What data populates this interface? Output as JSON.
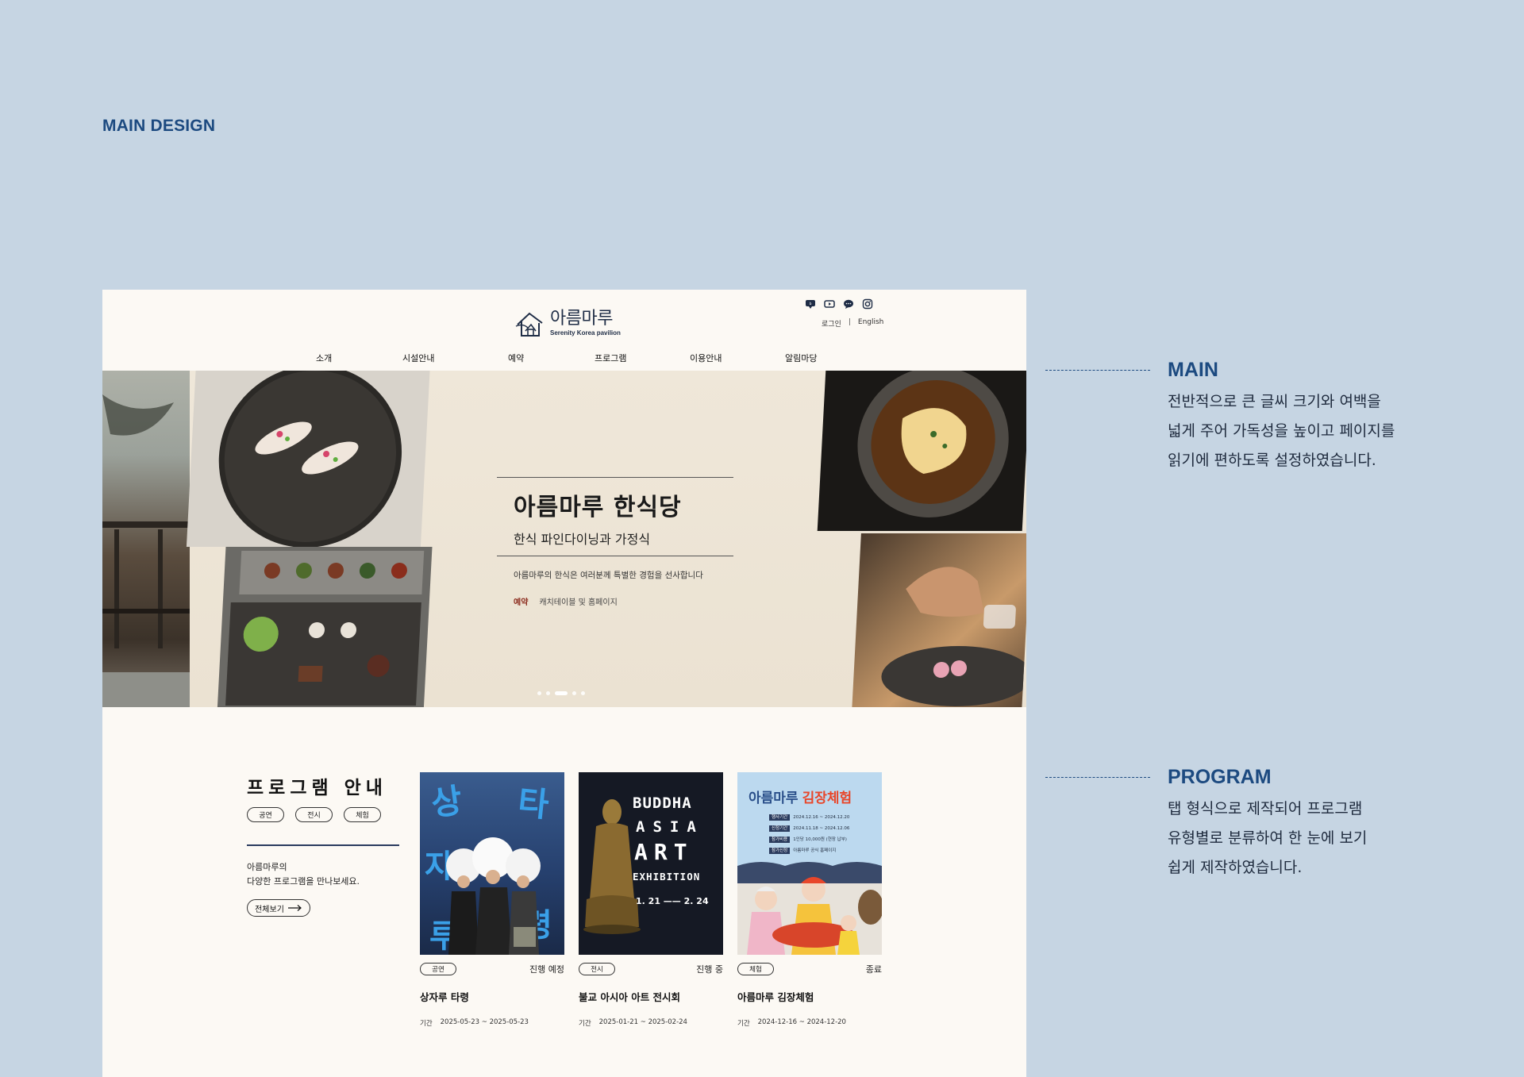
{
  "page_label": "MAIN DESIGN",
  "header": {
    "logo_name": "아름마루",
    "logo_sub": "Serenity Korea pavilion",
    "social_icons": [
      "blog-icon",
      "youtube-icon",
      "talk-icon",
      "instagram-icon"
    ],
    "login": "로그인",
    "separator": "|",
    "language": "English"
  },
  "nav": [
    "소개",
    "시설안내",
    "예약",
    "프로그램",
    "이용안내",
    "알림마당"
  ],
  "hero": {
    "title": "아름마루 한식당",
    "subtitle": "한식 파인다이닝과 가정식",
    "description": "아름마루의 한식은 여러분께 특별한 경험을 선사합니다",
    "cta_label": "예약",
    "cta_text": "캐치테이블 및 홈페이지",
    "slides": 5,
    "active_slide": 3
  },
  "program": {
    "title": "프로그램 안내",
    "tabs": [
      "공연",
      "전시",
      "체험"
    ],
    "desc_line1": "아름마루의",
    "desc_line2": "다양한 프로그램을 만나보세요.",
    "more": "전체보기",
    "cards": [
      {
        "poster_chars": [
          "상",
          "타",
          "자",
          "령",
          "루"
        ],
        "badge": "공연",
        "status": "진행 예정",
        "title": "상자루 타령",
        "date_label": "기간",
        "date": "2025-05-23 ~ 2025-05-23"
      },
      {
        "poster_lines": [
          "BUDDHA",
          "ASIA",
          "ART",
          "EXHIBITION"
        ],
        "poster_dates": "1. 21 —— 2. 24",
        "badge": "전시",
        "status": "진행 중",
        "title": "불교 아시아 아트 전시회",
        "date_label": "기간",
        "date": "2025-01-21 ~ 2025-02-24"
      },
      {
        "poster_title_a": "아름마루",
        "poster_title_b": "김장체험",
        "poster_rows": [
          {
            "k": "행사기간",
            "v": "2024.12.16 ~ 2024.12.20"
          },
          {
            "k": "신청기간",
            "v": "2024.11.18 ~ 2024.12.06"
          },
          {
            "k": "참가비용",
            "v": "1인당 10,000원 (현장 납부)"
          },
          {
            "k": "참가신청",
            "v": "아름마루 공식 홈페이지"
          }
        ],
        "badge": "체험",
        "status": "종료",
        "title": "아름마루 김장체험",
        "date_label": "기간",
        "date": "2024-12-16 ~ 2024-12-20"
      }
    ]
  },
  "notes": [
    {
      "heading": "MAIN",
      "lines": [
        "전반적으로 큰 글씨 크기와 여백을",
        "넓게 주어 가독성을 높이고 페이지를",
        "읽기에 편하도록 설정하였습니다."
      ]
    },
    {
      "heading": "PROGRAM",
      "lines": [
        "탭 형식으로 제작되어 프로그램",
        "유형별로 분류하여 한 눈에 보기",
        "쉽게 제작하였습니다."
      ]
    }
  ],
  "colors": {
    "background": "#c6d5e3",
    "accent": "#1c4a80",
    "page": "#fcf9f4",
    "cta": "#8b2a1c"
  }
}
